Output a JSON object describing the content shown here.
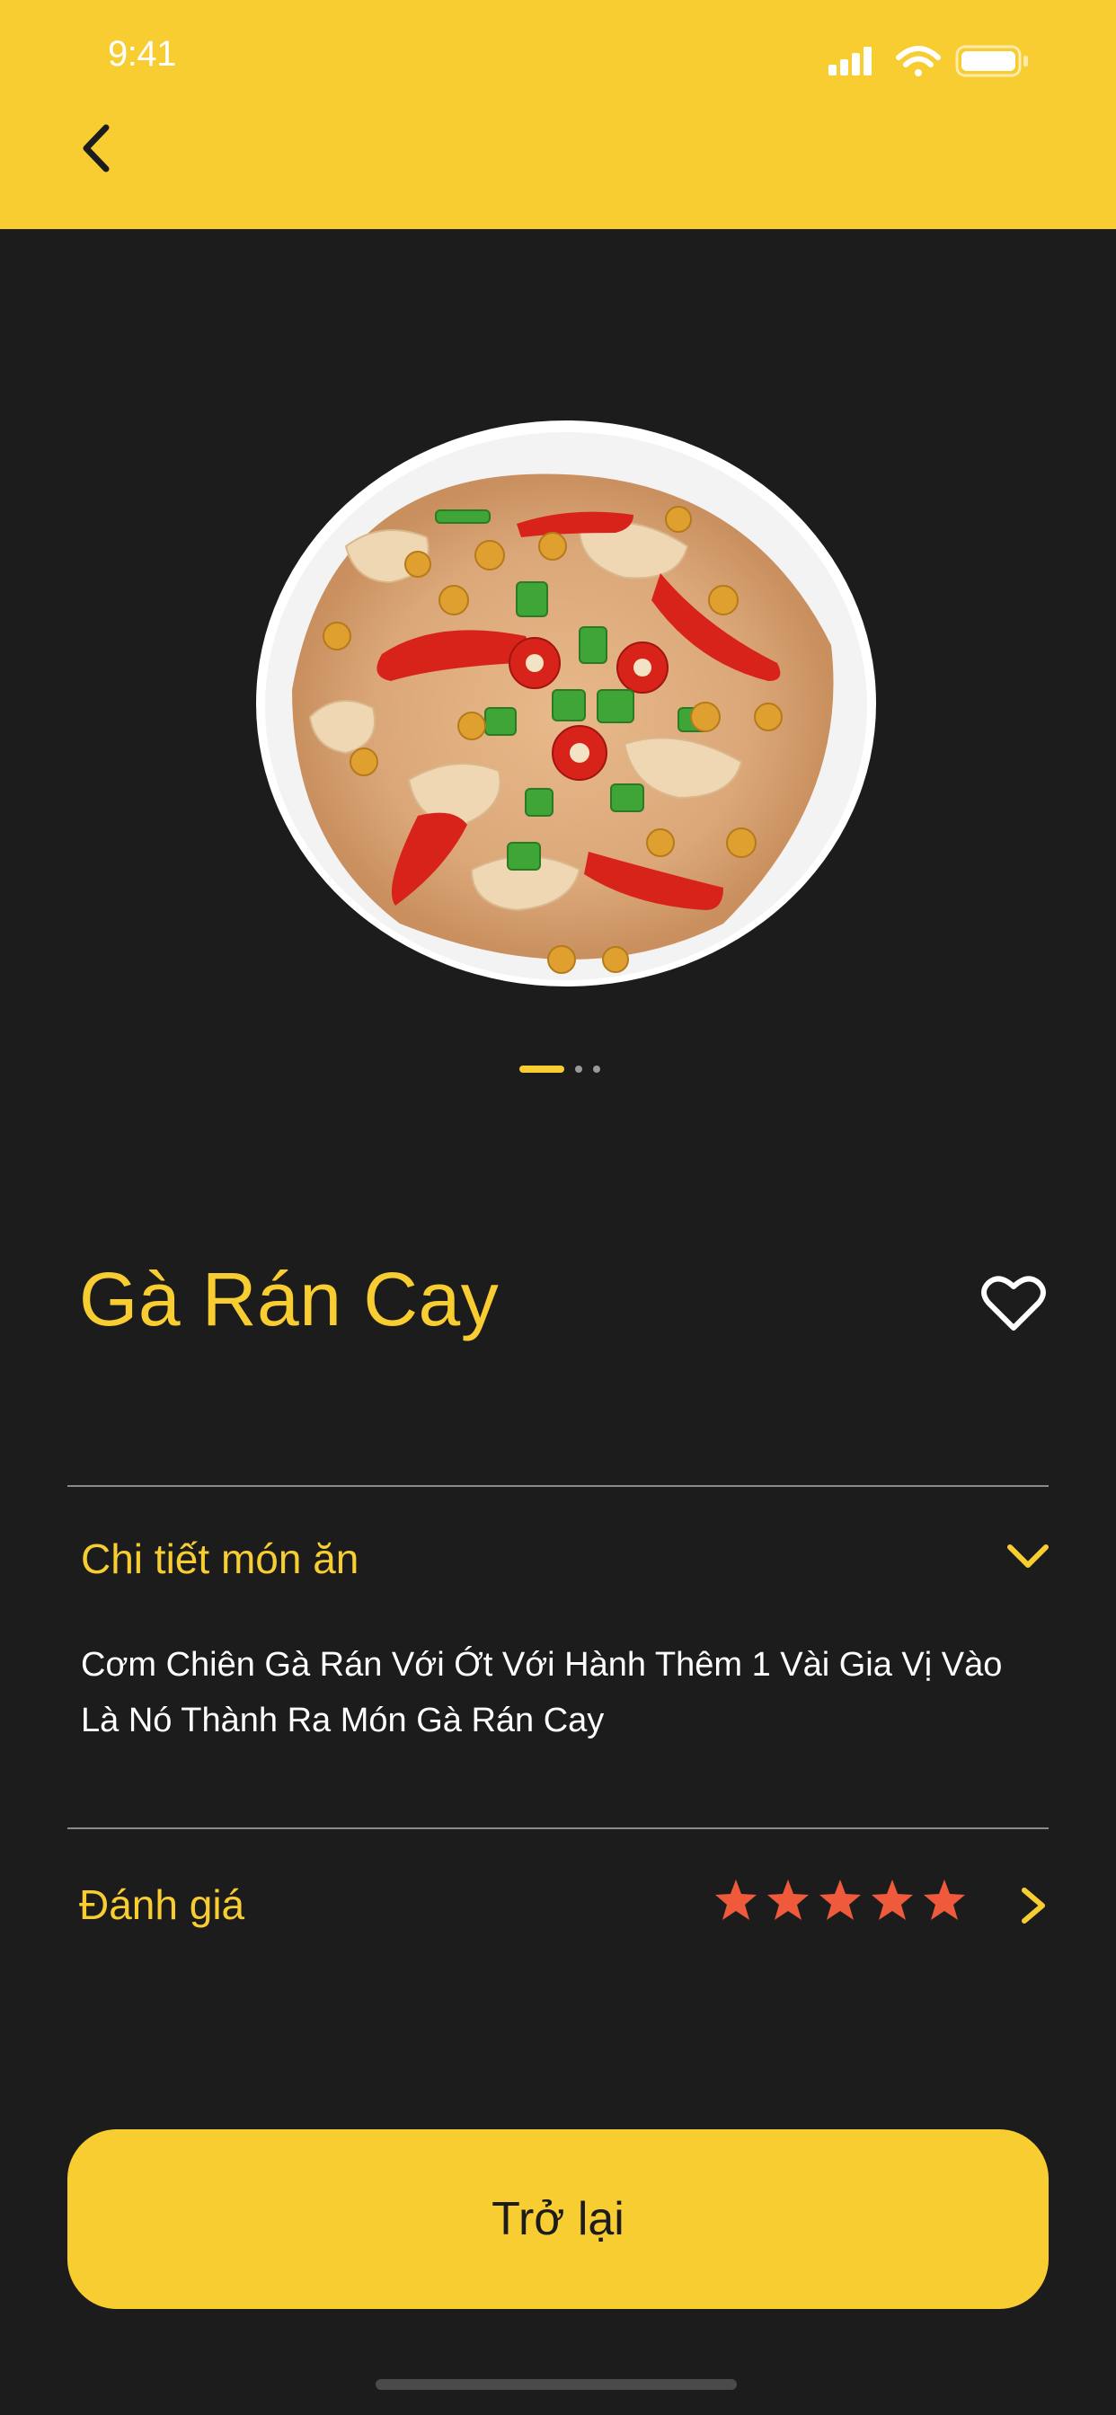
{
  "status_bar": {
    "time": "9:41"
  },
  "header": {
    "back_icon": "chevron-left-icon",
    "background_color": "#f8cd31"
  },
  "carousel": {
    "image": "fried-rice-chicken-plate",
    "page_count": 3,
    "active_index": 0
  },
  "dish": {
    "title": "Gà Rán Cay",
    "favorite_icon": "heart-outline-icon"
  },
  "details": {
    "label": "Chi tiết món ăn",
    "toggle_icon": "chevron-down-icon",
    "description": "Cơm Chiên Gà Rán Với Ớt Với Hành Thêm 1 Vài  Gia Vị Vào Là Nó Thành Ra Món Gà Rán Cay"
  },
  "rating": {
    "label": "Đánh giá",
    "stars": 5,
    "star_color": "#f05a3c",
    "chevron_icon": "chevron-right-icon"
  },
  "footer": {
    "back_button_label": "Trở lại"
  },
  "colors": {
    "accent": "#f8cd31",
    "background": "#1c1c1c",
    "text": "#ffffff"
  }
}
